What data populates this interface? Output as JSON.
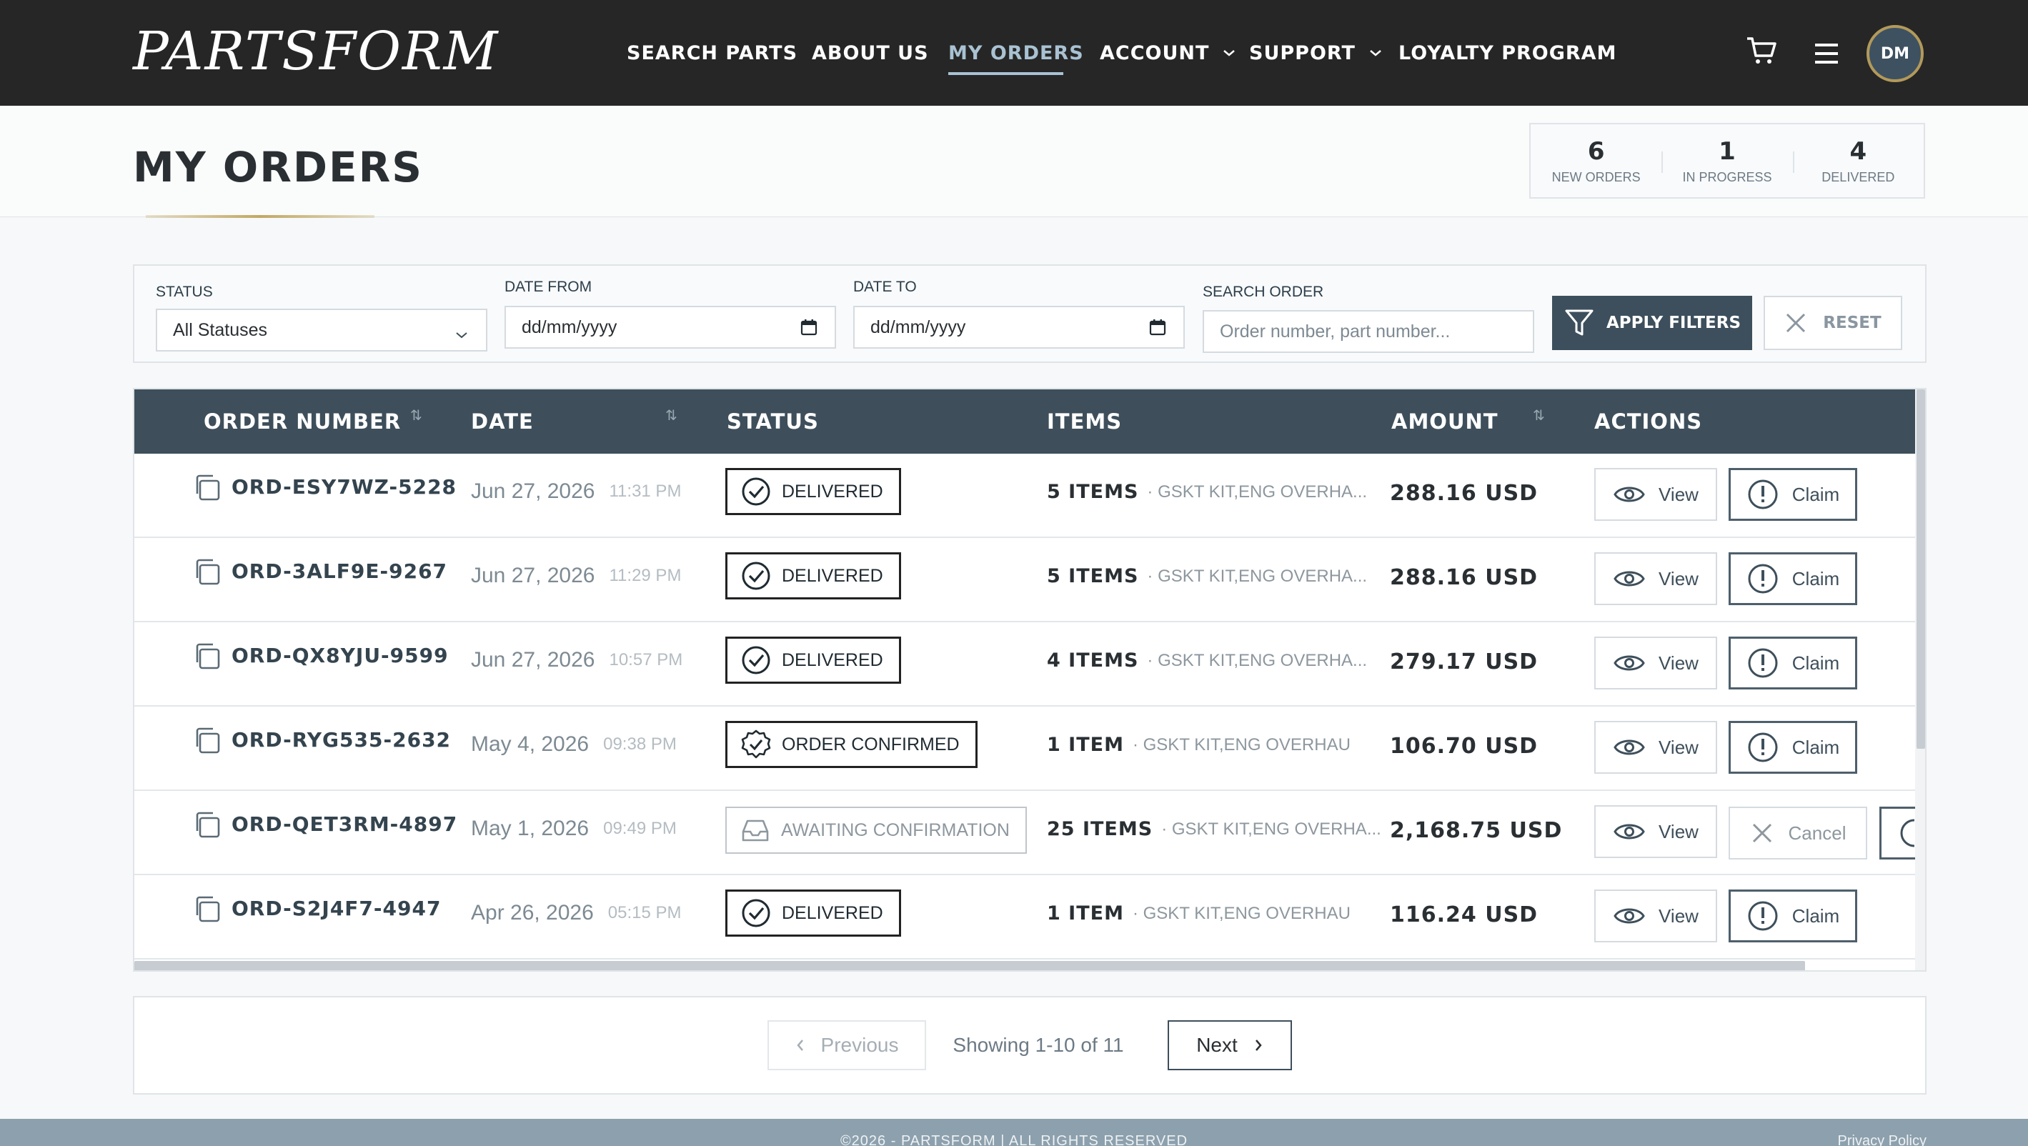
{
  "header": {
    "logo_text": "PARTSFORM",
    "nav": [
      {
        "label": "SEARCH PARTS",
        "active": false,
        "dropdown": false
      },
      {
        "label": "ABOUT US",
        "active": false,
        "dropdown": false
      },
      {
        "label": "MY ORDERS",
        "active": true,
        "dropdown": false
      },
      {
        "label": "ACCOUNT",
        "active": false,
        "dropdown": true
      },
      {
        "label": "SUPPORT",
        "active": false,
        "dropdown": true
      },
      {
        "label": "LOYALTY PROGRAM",
        "active": false,
        "dropdown": false
      }
    ],
    "icons": [
      "cart-icon",
      "menu-icon"
    ],
    "avatar_initials": "DM"
  },
  "page": {
    "title": "MY ORDERS"
  },
  "stats": [
    {
      "value": "6",
      "label": "NEW ORDERS"
    },
    {
      "value": "1",
      "label": "IN PROGRESS"
    },
    {
      "value": "4",
      "label": "DELIVERED"
    }
  ],
  "filters": {
    "status_label": "STATUS",
    "status_value": "All Statuses",
    "date_from_label": "DATE FROM",
    "date_from_value": "dd/mm/yyyy",
    "date_to_label": "DATE TO",
    "date_to_value": "dd/mm/yyyy",
    "search_label": "SEARCH ORDER",
    "search_placeholder": "Order number, part number...",
    "apply_label": "APPLY FILTERS",
    "reset_label": "RESET"
  },
  "table": {
    "columns": [
      "ORDER NUMBER",
      "DATE",
      "STATUS",
      "ITEMS",
      "AMOUNT",
      "ACTIONS"
    ],
    "rows": [
      {
        "order": "ORD-ESY7WZ-5228",
        "date": "Jun 27, 2026",
        "time": "11:31 PM",
        "status": "DELIVERED",
        "status_type": "delivered",
        "items": "5 ITEMS",
        "desc": "· GSKT KIT,ENG OVERHA...",
        "amount": "288.16 USD",
        "view": "View",
        "action2": "Claim",
        "action2_type": "claim"
      },
      {
        "order": "ORD-3ALF9E-9267",
        "date": "Jun 27, 2026",
        "time": "11:29 PM",
        "status": "DELIVERED",
        "status_type": "delivered",
        "items": "5 ITEMS",
        "desc": "· GSKT KIT,ENG OVERHA...",
        "amount": "288.16 USD",
        "view": "View",
        "action2": "Claim",
        "action2_type": "claim"
      },
      {
        "order": "ORD-QX8YJU-9599",
        "date": "Jun 27, 2026",
        "time": "10:57 PM",
        "status": "DELIVERED",
        "status_type": "delivered",
        "items": "4 ITEMS",
        "desc": "· GSKT KIT,ENG OVERHA...",
        "amount": "279.17 USD",
        "view": "View",
        "action2": "Claim",
        "action2_type": "claim"
      },
      {
        "order": "ORD-RYG535-2632",
        "date": "May 4, 2026",
        "time": "09:38 PM",
        "status": "ORDER CONFIRMED",
        "status_type": "confirmed",
        "items": "1 ITEM",
        "desc": "· GSKT KIT,ENG OVERHAU",
        "amount": "106.70 USD",
        "view": "View",
        "action2": "Claim",
        "action2_type": "claim"
      },
      {
        "order": "ORD-QET3RM-4897",
        "date": "May 1, 2026",
        "time": "09:49 PM",
        "status": "AWAITING CONFIRMATION",
        "status_type": "awaiting",
        "items": "25 ITEMS",
        "desc": "· GSKT KIT,ENG OVERHA...",
        "amount": "2,168.75 USD",
        "view": "View",
        "action2": "Cancel",
        "action2_type": "cancel"
      },
      {
        "order": "ORD-S2J4F7-4947",
        "date": "Apr 26, 2026",
        "time": "05:15 PM",
        "status": "DELIVERED",
        "status_type": "delivered",
        "items": "1 ITEM",
        "desc": "· GSKT KIT,ENG OVERHAU",
        "amount": "116.24 USD",
        "view": "View",
        "action2": "Claim",
        "action2_type": "claim"
      }
    ]
  },
  "pagination": {
    "prev_label": "Previous",
    "info": "Showing 1-10 of 11",
    "next_label": "Next"
  },
  "footer": {
    "copyright": "©2026 - PARTSFORM | ALL RIGHTS RESERVED",
    "privacy": "Privacy Policy"
  }
}
